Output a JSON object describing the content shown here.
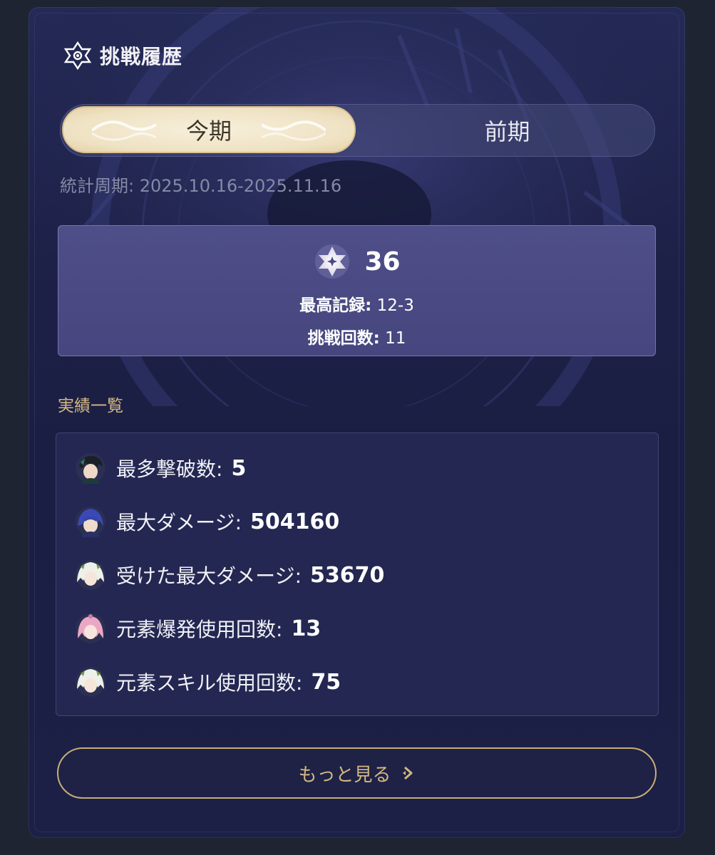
{
  "header": {
    "title": "挑戦履歴",
    "icon": "emblem-icon"
  },
  "tabs": [
    {
      "label": "今期",
      "active": true
    },
    {
      "label": "前期",
      "active": false
    }
  ],
  "period": "統計周期: 2025.10.16-2025.11.16",
  "summary": {
    "score_icon": "star-icon",
    "score": "36",
    "best_label": "最高記録:",
    "best_value": "12-3",
    "attempts_label": "挑戦回数:",
    "attempts_value": "11"
  },
  "achievements_title": "実績一覧",
  "achievements": [
    {
      "label": "最多撃破数:",
      "value": "5",
      "avatar": "character-avatar-dark-hair"
    },
    {
      "label": "最大ダメージ:",
      "value": "504160",
      "avatar": "character-avatar-blue-hair"
    },
    {
      "label": "受けた最大ダメージ:",
      "value": "53670",
      "avatar": "character-avatar-white-hair"
    },
    {
      "label": "元素爆発使用回数:",
      "value": "13",
      "avatar": "character-avatar-pink-hair"
    },
    {
      "label": "元素スキル使用回数:",
      "value": "75",
      "avatar": "character-avatar-white-hair"
    }
  ],
  "more_button": {
    "label": "もっと見る",
    "icon": "chevron-right-icon"
  },
  "colors": {
    "page_bg": "#1f2432",
    "card_bg": "#1d2148",
    "gold": "#c9ad78",
    "summary_bg": "#4b4a85",
    "achievements_bg": "#232751"
  }
}
